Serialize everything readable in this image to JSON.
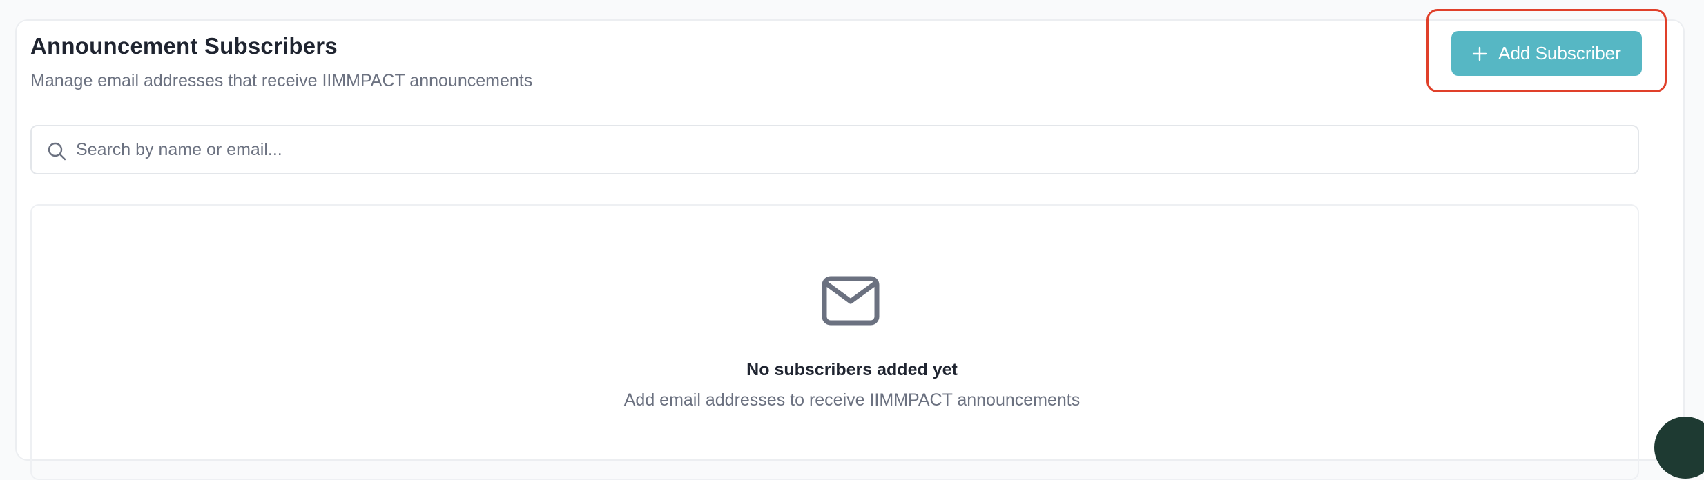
{
  "header": {
    "title": "Announcement Subscribers",
    "subtitle": "Manage email addresses that receive IIMMPACT announcements",
    "add_button_label": "Add Subscriber"
  },
  "search": {
    "placeholder": "Search by name or email...",
    "value": ""
  },
  "empty_state": {
    "icon": "mail-icon",
    "title": "No subscribers added yet",
    "message": "Add email addresses to receive IIMMPACT announcements"
  },
  "colors": {
    "accent": "#56b7c4",
    "highlight": "#e0402a"
  }
}
